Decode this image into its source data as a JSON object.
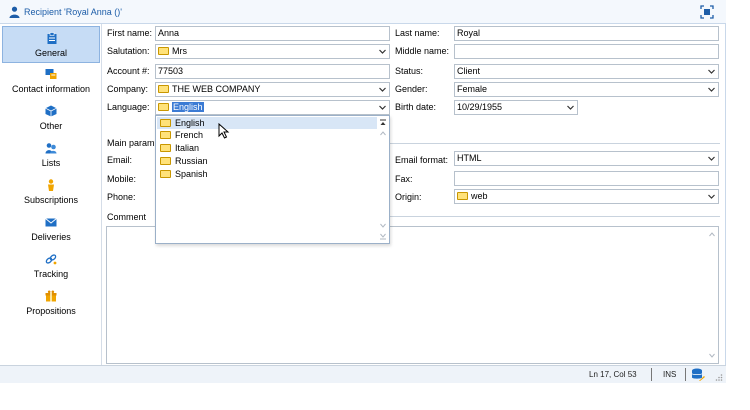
{
  "title": "Recipient 'Royal Anna ()'",
  "sidebar": {
    "items": [
      {
        "label": "General",
        "icon": "clipboard-icon",
        "active": true
      },
      {
        "label": "Contact information",
        "icon": "contact-icon",
        "active": false
      },
      {
        "label": "Other",
        "icon": "cube-icon",
        "active": false
      },
      {
        "label": "Lists",
        "icon": "lists-icon",
        "active": false
      },
      {
        "label": "Subscriptions",
        "icon": "subscriptions-icon",
        "active": false
      },
      {
        "label": "Deliveries",
        "icon": "envelope-icon",
        "active": false
      },
      {
        "label": "Tracking",
        "icon": "tracking-icon",
        "active": false
      },
      {
        "label": "Propositions",
        "icon": "gift-icon",
        "active": false
      }
    ]
  },
  "form": {
    "first_name": {
      "label": "First name:",
      "value": "Anna"
    },
    "last_name": {
      "label": "Last name:",
      "value": "Royal"
    },
    "salutation": {
      "label": "Salutation:",
      "value": "Mrs"
    },
    "middle_name": {
      "label": "Middle name:",
      "value": ""
    },
    "account": {
      "label": "Account #:",
      "value": "77503"
    },
    "status": {
      "label": "Status:",
      "value": "Client"
    },
    "company": {
      "label": "Company:",
      "value": "THE WEB COMPANY"
    },
    "gender": {
      "label": "Gender:",
      "value": "Female"
    },
    "language": {
      "label": "Language:",
      "value": "English"
    },
    "birth_date": {
      "label": "Birth date:",
      "value": "10/29/1955"
    },
    "main_params": {
      "label": "Main param"
    },
    "email": {
      "label": "Email:",
      "value": ""
    },
    "email_format": {
      "label": "Email format:",
      "value": "HTML"
    },
    "mobile": {
      "label": "Mobile:",
      "value": ""
    },
    "fax": {
      "label": "Fax:",
      "value": ""
    },
    "phone": {
      "label": "Phone:",
      "value": ""
    },
    "origin": {
      "label": "Origin:",
      "value": "web"
    },
    "comment": {
      "label": "Comment"
    }
  },
  "language_dropdown": {
    "options": [
      "English",
      "French",
      "Italian",
      "Russian",
      "Spanish"
    ],
    "highlighted": "English"
  },
  "statusbar": {
    "position": "Ln 17, Col 53",
    "mode": "INS"
  },
  "colors": {
    "accent": "#1d5da8",
    "active_nav": "#c6dcf5",
    "selection": "#3b7bd4",
    "folder_icon": "#ffe27a"
  }
}
